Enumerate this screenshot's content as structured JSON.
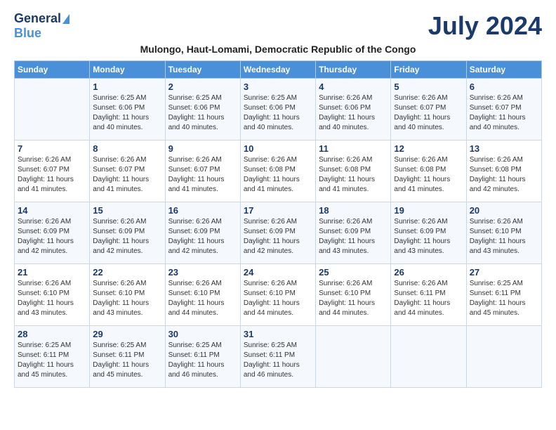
{
  "header": {
    "logo_general": "General",
    "logo_blue": "Blue",
    "month_title": "July 2024",
    "subtitle": "Mulongo, Haut-Lomami, Democratic Republic of the Congo"
  },
  "days_of_week": [
    "Sunday",
    "Monday",
    "Tuesday",
    "Wednesday",
    "Thursday",
    "Friday",
    "Saturday"
  ],
  "weeks": [
    [
      {
        "day": "",
        "sunrise": "",
        "sunset": "",
        "daylight": ""
      },
      {
        "day": "1",
        "sunrise": "Sunrise: 6:25 AM",
        "sunset": "Sunset: 6:06 PM",
        "daylight": "Daylight: 11 hours and 40 minutes."
      },
      {
        "day": "2",
        "sunrise": "Sunrise: 6:25 AM",
        "sunset": "Sunset: 6:06 PM",
        "daylight": "Daylight: 11 hours and 40 minutes."
      },
      {
        "day": "3",
        "sunrise": "Sunrise: 6:25 AM",
        "sunset": "Sunset: 6:06 PM",
        "daylight": "Daylight: 11 hours and 40 minutes."
      },
      {
        "day": "4",
        "sunrise": "Sunrise: 6:26 AM",
        "sunset": "Sunset: 6:06 PM",
        "daylight": "Daylight: 11 hours and 40 minutes."
      },
      {
        "day": "5",
        "sunrise": "Sunrise: 6:26 AM",
        "sunset": "Sunset: 6:07 PM",
        "daylight": "Daylight: 11 hours and 40 minutes."
      },
      {
        "day": "6",
        "sunrise": "Sunrise: 6:26 AM",
        "sunset": "Sunset: 6:07 PM",
        "daylight": "Daylight: 11 hours and 40 minutes."
      }
    ],
    [
      {
        "day": "7",
        "sunrise": "Sunrise: 6:26 AM",
        "sunset": "Sunset: 6:07 PM",
        "daylight": "Daylight: 11 hours and 41 minutes."
      },
      {
        "day": "8",
        "sunrise": "Sunrise: 6:26 AM",
        "sunset": "Sunset: 6:07 PM",
        "daylight": "Daylight: 11 hours and 41 minutes."
      },
      {
        "day": "9",
        "sunrise": "Sunrise: 6:26 AM",
        "sunset": "Sunset: 6:07 PM",
        "daylight": "Daylight: 11 hours and 41 minutes."
      },
      {
        "day": "10",
        "sunrise": "Sunrise: 6:26 AM",
        "sunset": "Sunset: 6:08 PM",
        "daylight": "Daylight: 11 hours and 41 minutes."
      },
      {
        "day": "11",
        "sunrise": "Sunrise: 6:26 AM",
        "sunset": "Sunset: 6:08 PM",
        "daylight": "Daylight: 11 hours and 41 minutes."
      },
      {
        "day": "12",
        "sunrise": "Sunrise: 6:26 AM",
        "sunset": "Sunset: 6:08 PM",
        "daylight": "Daylight: 11 hours and 41 minutes."
      },
      {
        "day": "13",
        "sunrise": "Sunrise: 6:26 AM",
        "sunset": "Sunset: 6:08 PM",
        "daylight": "Daylight: 11 hours and 42 minutes."
      }
    ],
    [
      {
        "day": "14",
        "sunrise": "Sunrise: 6:26 AM",
        "sunset": "Sunset: 6:09 PM",
        "daylight": "Daylight: 11 hours and 42 minutes."
      },
      {
        "day": "15",
        "sunrise": "Sunrise: 6:26 AM",
        "sunset": "Sunset: 6:09 PM",
        "daylight": "Daylight: 11 hours and 42 minutes."
      },
      {
        "day": "16",
        "sunrise": "Sunrise: 6:26 AM",
        "sunset": "Sunset: 6:09 PM",
        "daylight": "Daylight: 11 hours and 42 minutes."
      },
      {
        "day": "17",
        "sunrise": "Sunrise: 6:26 AM",
        "sunset": "Sunset: 6:09 PM",
        "daylight": "Daylight: 11 hours and 42 minutes."
      },
      {
        "day": "18",
        "sunrise": "Sunrise: 6:26 AM",
        "sunset": "Sunset: 6:09 PM",
        "daylight": "Daylight: 11 hours and 43 minutes."
      },
      {
        "day": "19",
        "sunrise": "Sunrise: 6:26 AM",
        "sunset": "Sunset: 6:09 PM",
        "daylight": "Daylight: 11 hours and 43 minutes."
      },
      {
        "day": "20",
        "sunrise": "Sunrise: 6:26 AM",
        "sunset": "Sunset: 6:10 PM",
        "daylight": "Daylight: 11 hours and 43 minutes."
      }
    ],
    [
      {
        "day": "21",
        "sunrise": "Sunrise: 6:26 AM",
        "sunset": "Sunset: 6:10 PM",
        "daylight": "Daylight: 11 hours and 43 minutes."
      },
      {
        "day": "22",
        "sunrise": "Sunrise: 6:26 AM",
        "sunset": "Sunset: 6:10 PM",
        "daylight": "Daylight: 11 hours and 43 minutes."
      },
      {
        "day": "23",
        "sunrise": "Sunrise: 6:26 AM",
        "sunset": "Sunset: 6:10 PM",
        "daylight": "Daylight: 11 hours and 44 minutes."
      },
      {
        "day": "24",
        "sunrise": "Sunrise: 6:26 AM",
        "sunset": "Sunset: 6:10 PM",
        "daylight": "Daylight: 11 hours and 44 minutes."
      },
      {
        "day": "25",
        "sunrise": "Sunrise: 6:26 AM",
        "sunset": "Sunset: 6:10 PM",
        "daylight": "Daylight: 11 hours and 44 minutes."
      },
      {
        "day": "26",
        "sunrise": "Sunrise: 6:26 AM",
        "sunset": "Sunset: 6:11 PM",
        "daylight": "Daylight: 11 hours and 44 minutes."
      },
      {
        "day": "27",
        "sunrise": "Sunrise: 6:25 AM",
        "sunset": "Sunset: 6:11 PM",
        "daylight": "Daylight: 11 hours and 45 minutes."
      }
    ],
    [
      {
        "day": "28",
        "sunrise": "Sunrise: 6:25 AM",
        "sunset": "Sunset: 6:11 PM",
        "daylight": "Daylight: 11 hours and 45 minutes."
      },
      {
        "day": "29",
        "sunrise": "Sunrise: 6:25 AM",
        "sunset": "Sunset: 6:11 PM",
        "daylight": "Daylight: 11 hours and 45 minutes."
      },
      {
        "day": "30",
        "sunrise": "Sunrise: 6:25 AM",
        "sunset": "Sunset: 6:11 PM",
        "daylight": "Daylight: 11 hours and 46 minutes."
      },
      {
        "day": "31",
        "sunrise": "Sunrise: 6:25 AM",
        "sunset": "Sunset: 6:11 PM",
        "daylight": "Daylight: 11 hours and 46 minutes."
      },
      {
        "day": "",
        "sunrise": "",
        "sunset": "",
        "daylight": ""
      },
      {
        "day": "",
        "sunrise": "",
        "sunset": "",
        "daylight": ""
      },
      {
        "day": "",
        "sunrise": "",
        "sunset": "",
        "daylight": ""
      }
    ]
  ]
}
